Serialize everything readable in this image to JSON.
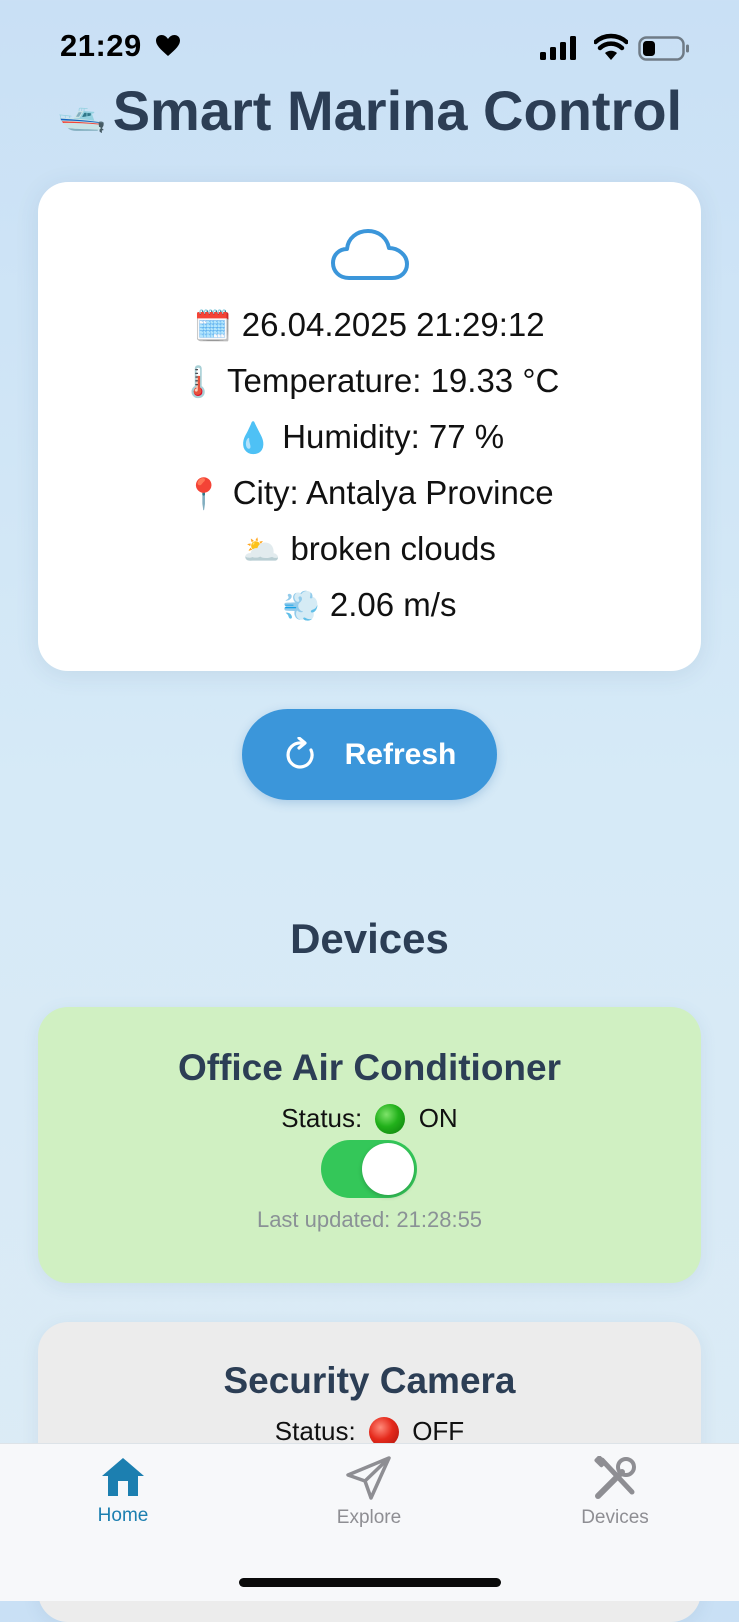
{
  "status_bar": {
    "time": "21:29",
    "icons": [
      "heart-icon",
      "signal-icon",
      "wifi-icon",
      "battery-icon"
    ]
  },
  "header": {
    "icon": "🛥️",
    "title": "Smart Marina Control"
  },
  "weather": {
    "condition_icon": "cloud-icon",
    "lines": [
      {
        "emoji": "🗓️",
        "text": "26.04.2025 21:29:12"
      },
      {
        "emoji": "🌡️",
        "text": "Temperature: 19.33 °C"
      },
      {
        "emoji": "💧",
        "text": "Humidity: 77 %"
      },
      {
        "emoji": "📍",
        "text": "City: Antalya Province"
      },
      {
        "emoji": "🌥️",
        "text": "broken clouds"
      },
      {
        "emoji": "💨",
        "text": "2.06 m/s"
      }
    ]
  },
  "refresh_label": "Refresh",
  "devices_title": "Devices",
  "devices": [
    {
      "name": "Office Air Conditioner",
      "status_prefix": "Status:",
      "status": "ON",
      "toggle_on": true,
      "last_updated": "Last updated: 21:28:55",
      "card_color": "#d0f0c2"
    },
    {
      "name": "Security Camera",
      "status_prefix": "Status:",
      "status": "OFF",
      "card_color": "#ececec"
    }
  ],
  "tabs": [
    {
      "label": "Home",
      "icon": "home-icon",
      "active": true
    },
    {
      "label": "Explore",
      "icon": "paper-plane-icon",
      "active": false
    },
    {
      "label": "Devices",
      "icon": "tools-icon",
      "active": false
    }
  ],
  "colors": {
    "accent": "#3b96da",
    "active_tab": "#1c7fb0",
    "toggle_on": "#34c759",
    "title": "#2c3e55"
  }
}
